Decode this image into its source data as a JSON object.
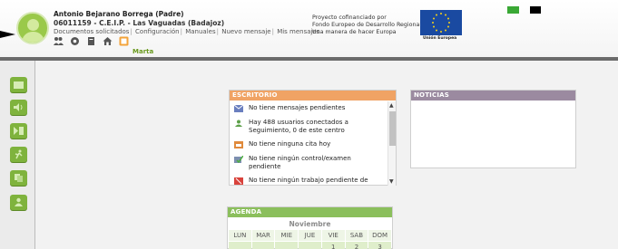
{
  "header": {
    "user_name": "Antonio Bejarano Borrega (Padre)",
    "school": "06011159 - C.E.I.P. - Las Vaguadas (Badajoz)",
    "nav": [
      "Documentos solicitados",
      "Configuración",
      "Manuales",
      "Nuevo mensaje",
      "Mis mensajes"
    ],
    "user_short": "Marta",
    "eu_text": [
      "Proyecto cofinanciado por",
      "Fondo Europeo de Desarrollo Regional",
      "Una manera de hacer Europa"
    ],
    "eu_caption": "Unión Europea"
  },
  "sidebar": {
    "icons": [
      "home-icon",
      "sound-icon",
      "media-icon",
      "runner-icon",
      "copy-icon",
      "person-icon"
    ]
  },
  "escritorio": {
    "title": "ESCRITORIO",
    "items": [
      {
        "text": "No tiene mensajes pendientes",
        "icon": "mail-icon"
      },
      {
        "text": "Hay 488 usuarios conectados a Seguimiento, 0 de este centro",
        "icon": "users-icon"
      },
      {
        "text": "No tiene ninguna cita hoy",
        "icon": "calendar-icon"
      },
      {
        "text": "No tiene ningún control/examen pendiente",
        "icon": "exam-icon"
      },
      {
        "text": "No tiene ningún trabajo pendiente de",
        "icon": "work-icon"
      }
    ]
  },
  "noticias": {
    "title": "NOTICIAS"
  },
  "agenda": {
    "title": "AGENDA",
    "month": "Noviembre",
    "days": [
      "LUN",
      "MAR",
      "MIE",
      "JUE",
      "VIE",
      "SAB",
      "DOM"
    ],
    "first_week": [
      "",
      "",
      "",
      "",
      "1",
      "2",
      "3"
    ]
  },
  "colors": {
    "escritorio_header": "#f0a364",
    "noticias_header": "#9b8aa0",
    "agenda_header": "#8bbf5c",
    "sidebar_button": "#7fb33d"
  }
}
